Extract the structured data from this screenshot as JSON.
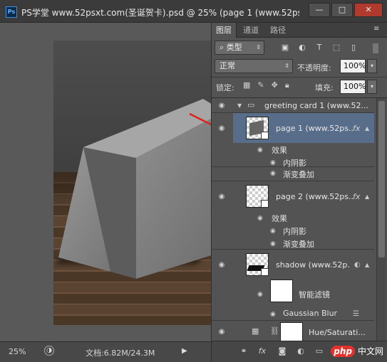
{
  "app": {
    "logo": "Ps",
    "title": "PS学堂 www.52psxt.com(圣诞贺卡).psd @ 25% (page 1 (www.52psxt.co"
  },
  "window": {
    "minimize": "—",
    "maximize": "□",
    "close": "✕"
  },
  "status": {
    "zoom": "25%",
    "doc_info": "文档:6.82M/24.3M"
  },
  "panel": {
    "tabs": [
      "图层",
      "通道",
      "路径"
    ],
    "filter_kind": "类型",
    "blend_mode": "正常",
    "opacity_label": "不透明度:",
    "opacity_value": "100%",
    "lock_label": "锁定:",
    "fill_label": "填充:",
    "fill_value": "100%"
  },
  "layers": {
    "group": "greeting card 1 (www.52...",
    "page1": {
      "name": "page 1 (www.52ps...",
      "fx": "fx",
      "effects": "效果",
      "e1": "内阴影",
      "e2": "渐变叠加"
    },
    "page2": {
      "name": "page 2 (www.52ps...",
      "fx": "fx",
      "effects": "效果",
      "e1": "内阴影",
      "e2": "渐变叠加"
    },
    "shadow": {
      "name": "shadow (www.52p...",
      "filters": "智能滤镜",
      "f1": "Gaussian Blur"
    },
    "hue": {
      "name": "Hue/Saturati..."
    }
  },
  "watermark": {
    "php": "php",
    "cn": "中文网"
  },
  "colors": {
    "selection": "#586d8a",
    "arrow": "#e0211b",
    "close": "#b03a2e"
  }
}
